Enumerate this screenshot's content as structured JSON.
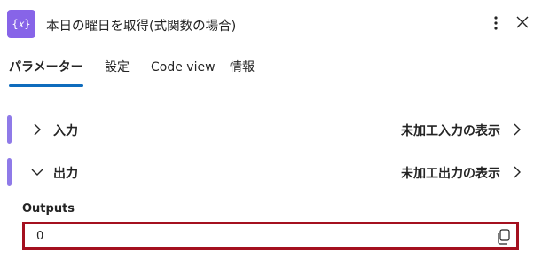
{
  "header": {
    "icon_glyph": "{𝑥}",
    "title": "本日の曜日を取得(式関数の場合)"
  },
  "tabs": [
    {
      "label": "パラメーター",
      "active": true
    },
    {
      "label": "設定",
      "active": false
    },
    {
      "label": "Code view",
      "active": false
    },
    {
      "label": "情報",
      "active": false
    }
  ],
  "sections": {
    "input": {
      "label": "入力",
      "expanded": false,
      "raw_link": "未加工入力の表示"
    },
    "output": {
      "label": "出力",
      "expanded": true,
      "raw_link": "未加工出力の表示"
    }
  },
  "outputs": {
    "label": "Outputs",
    "value": "0"
  },
  "colors": {
    "accent": "#8764e8",
    "section_bar": "#8f7ae8",
    "tab_underline": "#0f6cbd",
    "highlight_border": "#a4101f"
  },
  "icons": [
    "variable-action-icon",
    "more-vertical-icon",
    "close-icon",
    "chevron-right-icon",
    "chevron-down-icon",
    "copy-icon"
  ]
}
